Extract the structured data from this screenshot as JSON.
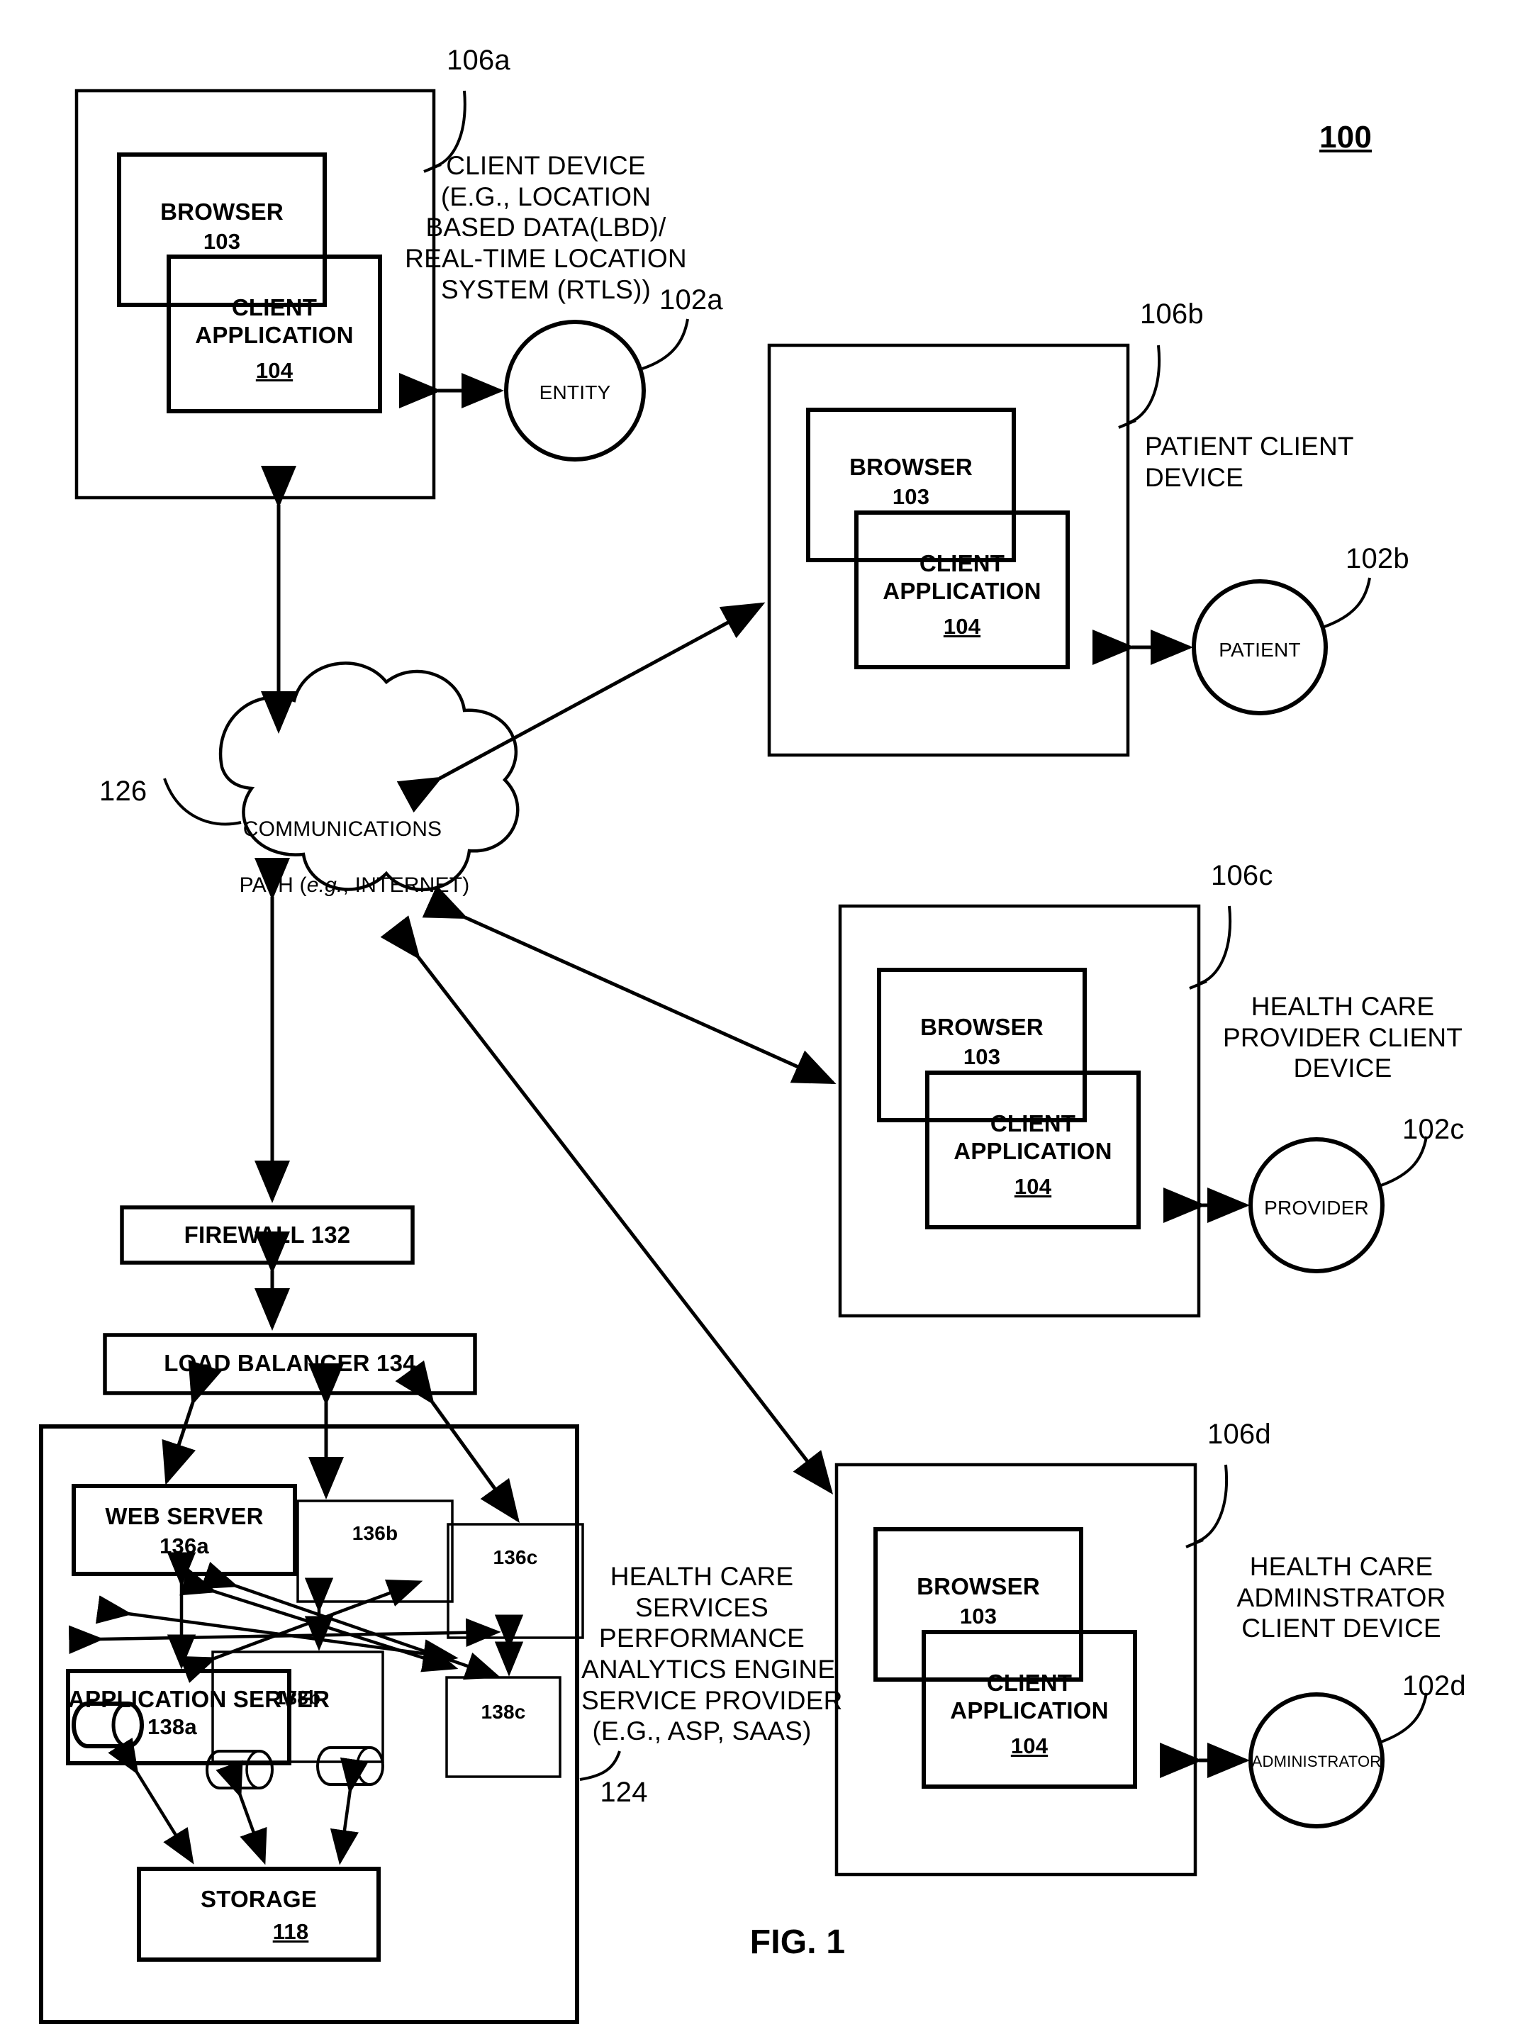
{
  "figure": {
    "caption": "FIG. 1",
    "system_ref": "100"
  },
  "client_devices": [
    {
      "id": "client-device-a",
      "ref": "106a",
      "description": "CLIENT DEVICE\n(E.G., LOCATION\nBASED DATA(LBD)/\nREAL-TIME LOCATION\nSYSTEM (RTLS))",
      "browser": {
        "label": "BROWSER",
        "num": "103"
      },
      "client_application": {
        "label": "CLIENT\nAPPLICATION",
        "num": "104"
      },
      "actor": {
        "label": "ENTITY",
        "ref": "102a"
      }
    },
    {
      "id": "client-device-b",
      "ref": "106b",
      "description": "PATIENT CLIENT\nDEVICE",
      "browser": {
        "label": "BROWSER",
        "num": "103"
      },
      "client_application": {
        "label": "CLIENT\nAPPLICATION",
        "num": "104"
      },
      "actor": {
        "label": "PATIENT",
        "ref": "102b"
      }
    },
    {
      "id": "client-device-c",
      "ref": "106c",
      "description": "HEALTH CARE\nPROVIDER CLIENT\nDEVICE",
      "browser": {
        "label": "BROWSER",
        "num": "103"
      },
      "client_application": {
        "label": "CLIENT\nAPPLICATION",
        "num": "104"
      },
      "actor": {
        "label": "PROVIDER",
        "ref": "102c"
      }
    },
    {
      "id": "client-device-d",
      "ref": "106d",
      "description": "HEALTH CARE\nADMINSTRATOR\nCLIENT DEVICE",
      "browser": {
        "label": "BROWSER",
        "num": "103"
      },
      "client_application": {
        "label": "CLIENT\nAPPLICATION",
        "num": "104"
      },
      "actor": {
        "label": "ADMINISTRATOR",
        "ref": "102d"
      }
    }
  ],
  "network": {
    "cloud_line1": "COMMUNICATIONS",
    "cloud_line2_pre": "PATH (",
    "cloud_line2_ital": "e.g.",
    "cloud_line2_post": ", INTERNET)",
    "ref": "126"
  },
  "backend": {
    "firewall": "FIREWALL 132",
    "load_balancer": "LOAD BALANCER 134",
    "web_servers": [
      {
        "label": "WEB SERVER",
        "num": "136a"
      },
      {
        "label": "",
        "num": "136b"
      },
      {
        "label": "",
        "num": "136c"
      }
    ],
    "application_servers": [
      {
        "label": "APPLICATION SERVER",
        "num": "138a"
      },
      {
        "label": "",
        "num": "138b"
      },
      {
        "label": "",
        "num": "138c"
      }
    ],
    "storage": {
      "label": "STORAGE",
      "num": "118"
    },
    "provider_description": "HEALTH CARE\nSERVICES\nPERFORMANCE\nANALYTICS ENGINE\nSERVICE PROVIDER\n(E.G., ASP, SAAS)",
    "provider_ref": "124"
  }
}
